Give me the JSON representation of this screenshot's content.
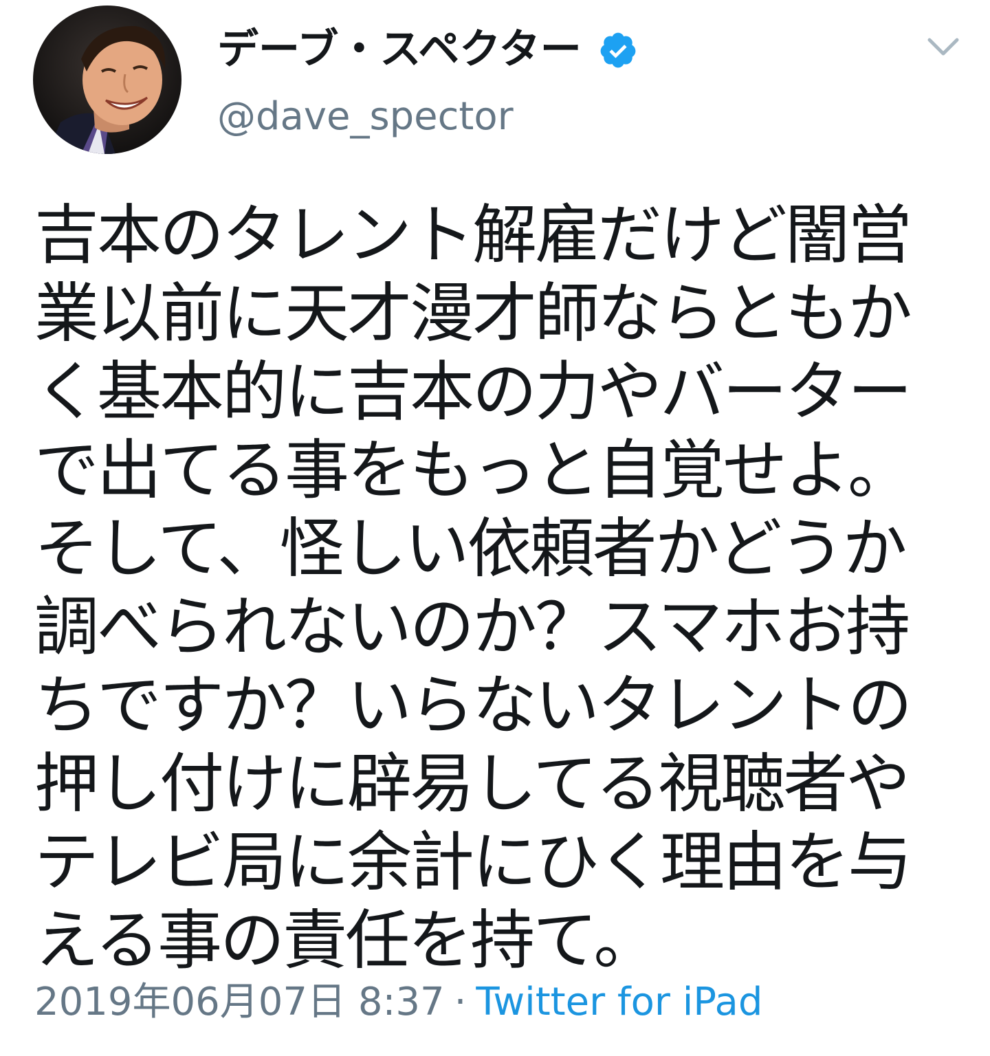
{
  "tweet": {
    "author": {
      "display_name": "デーブ・スペクター",
      "handle": "@dave_spector",
      "verified": true,
      "avatar_icon": "profile-photo"
    },
    "text": "吉本のタレント解雇だけど闇営業以前に天才漫才師ならともかく基本的に吉本の力やバーターで出てる事をもっと自覚せよ。\nそして、怪しい依頼者かどうか調べられないのか？スマホお持ちですか？いらないタレントの押し付けに辟易してる視聴者やテレビ局に余計にひく理由を与える事の責任を持て。",
    "timestamp": "2019年06月07日 8:37",
    "separator": "·",
    "source": "Twitter for iPad"
  },
  "icons": {
    "verified": "verified-badge-icon",
    "menu": "chevron-down-icon"
  },
  "colors": {
    "text": "#14171a",
    "secondary": "#657786",
    "link": "#1b95e0",
    "verified_badge": "#1da1f2"
  }
}
